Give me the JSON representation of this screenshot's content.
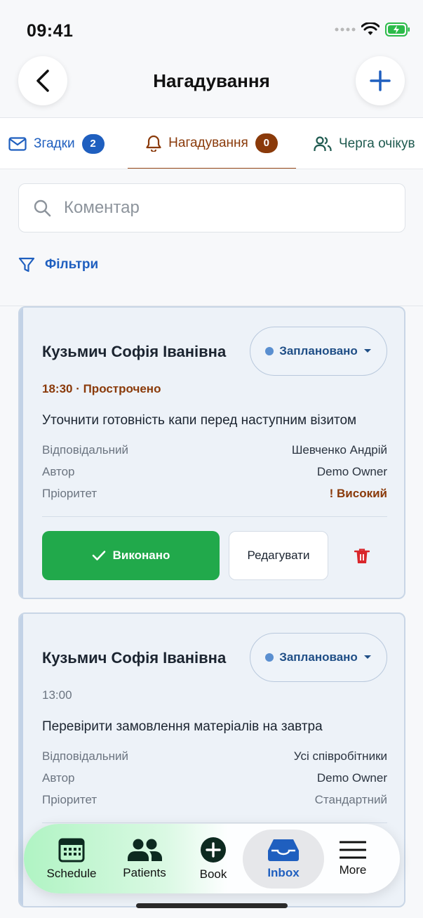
{
  "status_bar": {
    "time": "09:41"
  },
  "nav": {
    "title": "Нагадування"
  },
  "tabs": [
    {
      "label": "Згадки",
      "badge": "2",
      "icon": "mail-icon"
    },
    {
      "label": "Нагадування",
      "badge": "0",
      "icon": "bell-icon",
      "active": true
    },
    {
      "label": "Черга очікув",
      "icon": "users-icon"
    }
  ],
  "search": {
    "placeholder": "Коментар",
    "value": ""
  },
  "filters": {
    "label": "Фільтри"
  },
  "cards": [
    {
      "patient": "Кузьмич Софія Іванівна",
      "status": "Заплановано",
      "time": "18:30 · Прострочено",
      "text": "Уточнити готовність капи перед наступним візитом",
      "meta": [
        {
          "label": "Відповідальний",
          "value": "Шевченко Андрій"
        },
        {
          "label": "Автор",
          "value": "Demo Owner"
        },
        {
          "label": "Пріоритет",
          "value": "! Високий"
        }
      ],
      "done_label": "Виконано",
      "edit_label": "Редагувати"
    },
    {
      "patient": "Кузьмич Софія Іванівна",
      "status": "Заплановано",
      "time": "13:00",
      "text": "Перевірити замовлення матеріалів на завтра",
      "meta": [
        {
          "label": "Відповідальний",
          "value": "Усі співробітники"
        },
        {
          "label": "Автор",
          "value": "Demo Owner"
        },
        {
          "label": "Пріоритет",
          "value": "Стандартний"
        }
      ]
    }
  ],
  "tabbar": [
    {
      "label": "Schedule",
      "icon": "calendar-icon"
    },
    {
      "label": "Patients",
      "icon": "people-icon"
    },
    {
      "label": "Book",
      "icon": "plus-circle-icon"
    },
    {
      "label": "Inbox",
      "icon": "inbox-icon",
      "active": true
    },
    {
      "label": "More",
      "icon": "menu-icon"
    }
  ],
  "colors": {
    "accent_blue": "#1f5fbf",
    "overdue_brown": "#8a3a0a",
    "done_green": "#21a94b",
    "delete_red": "#d9262b"
  }
}
